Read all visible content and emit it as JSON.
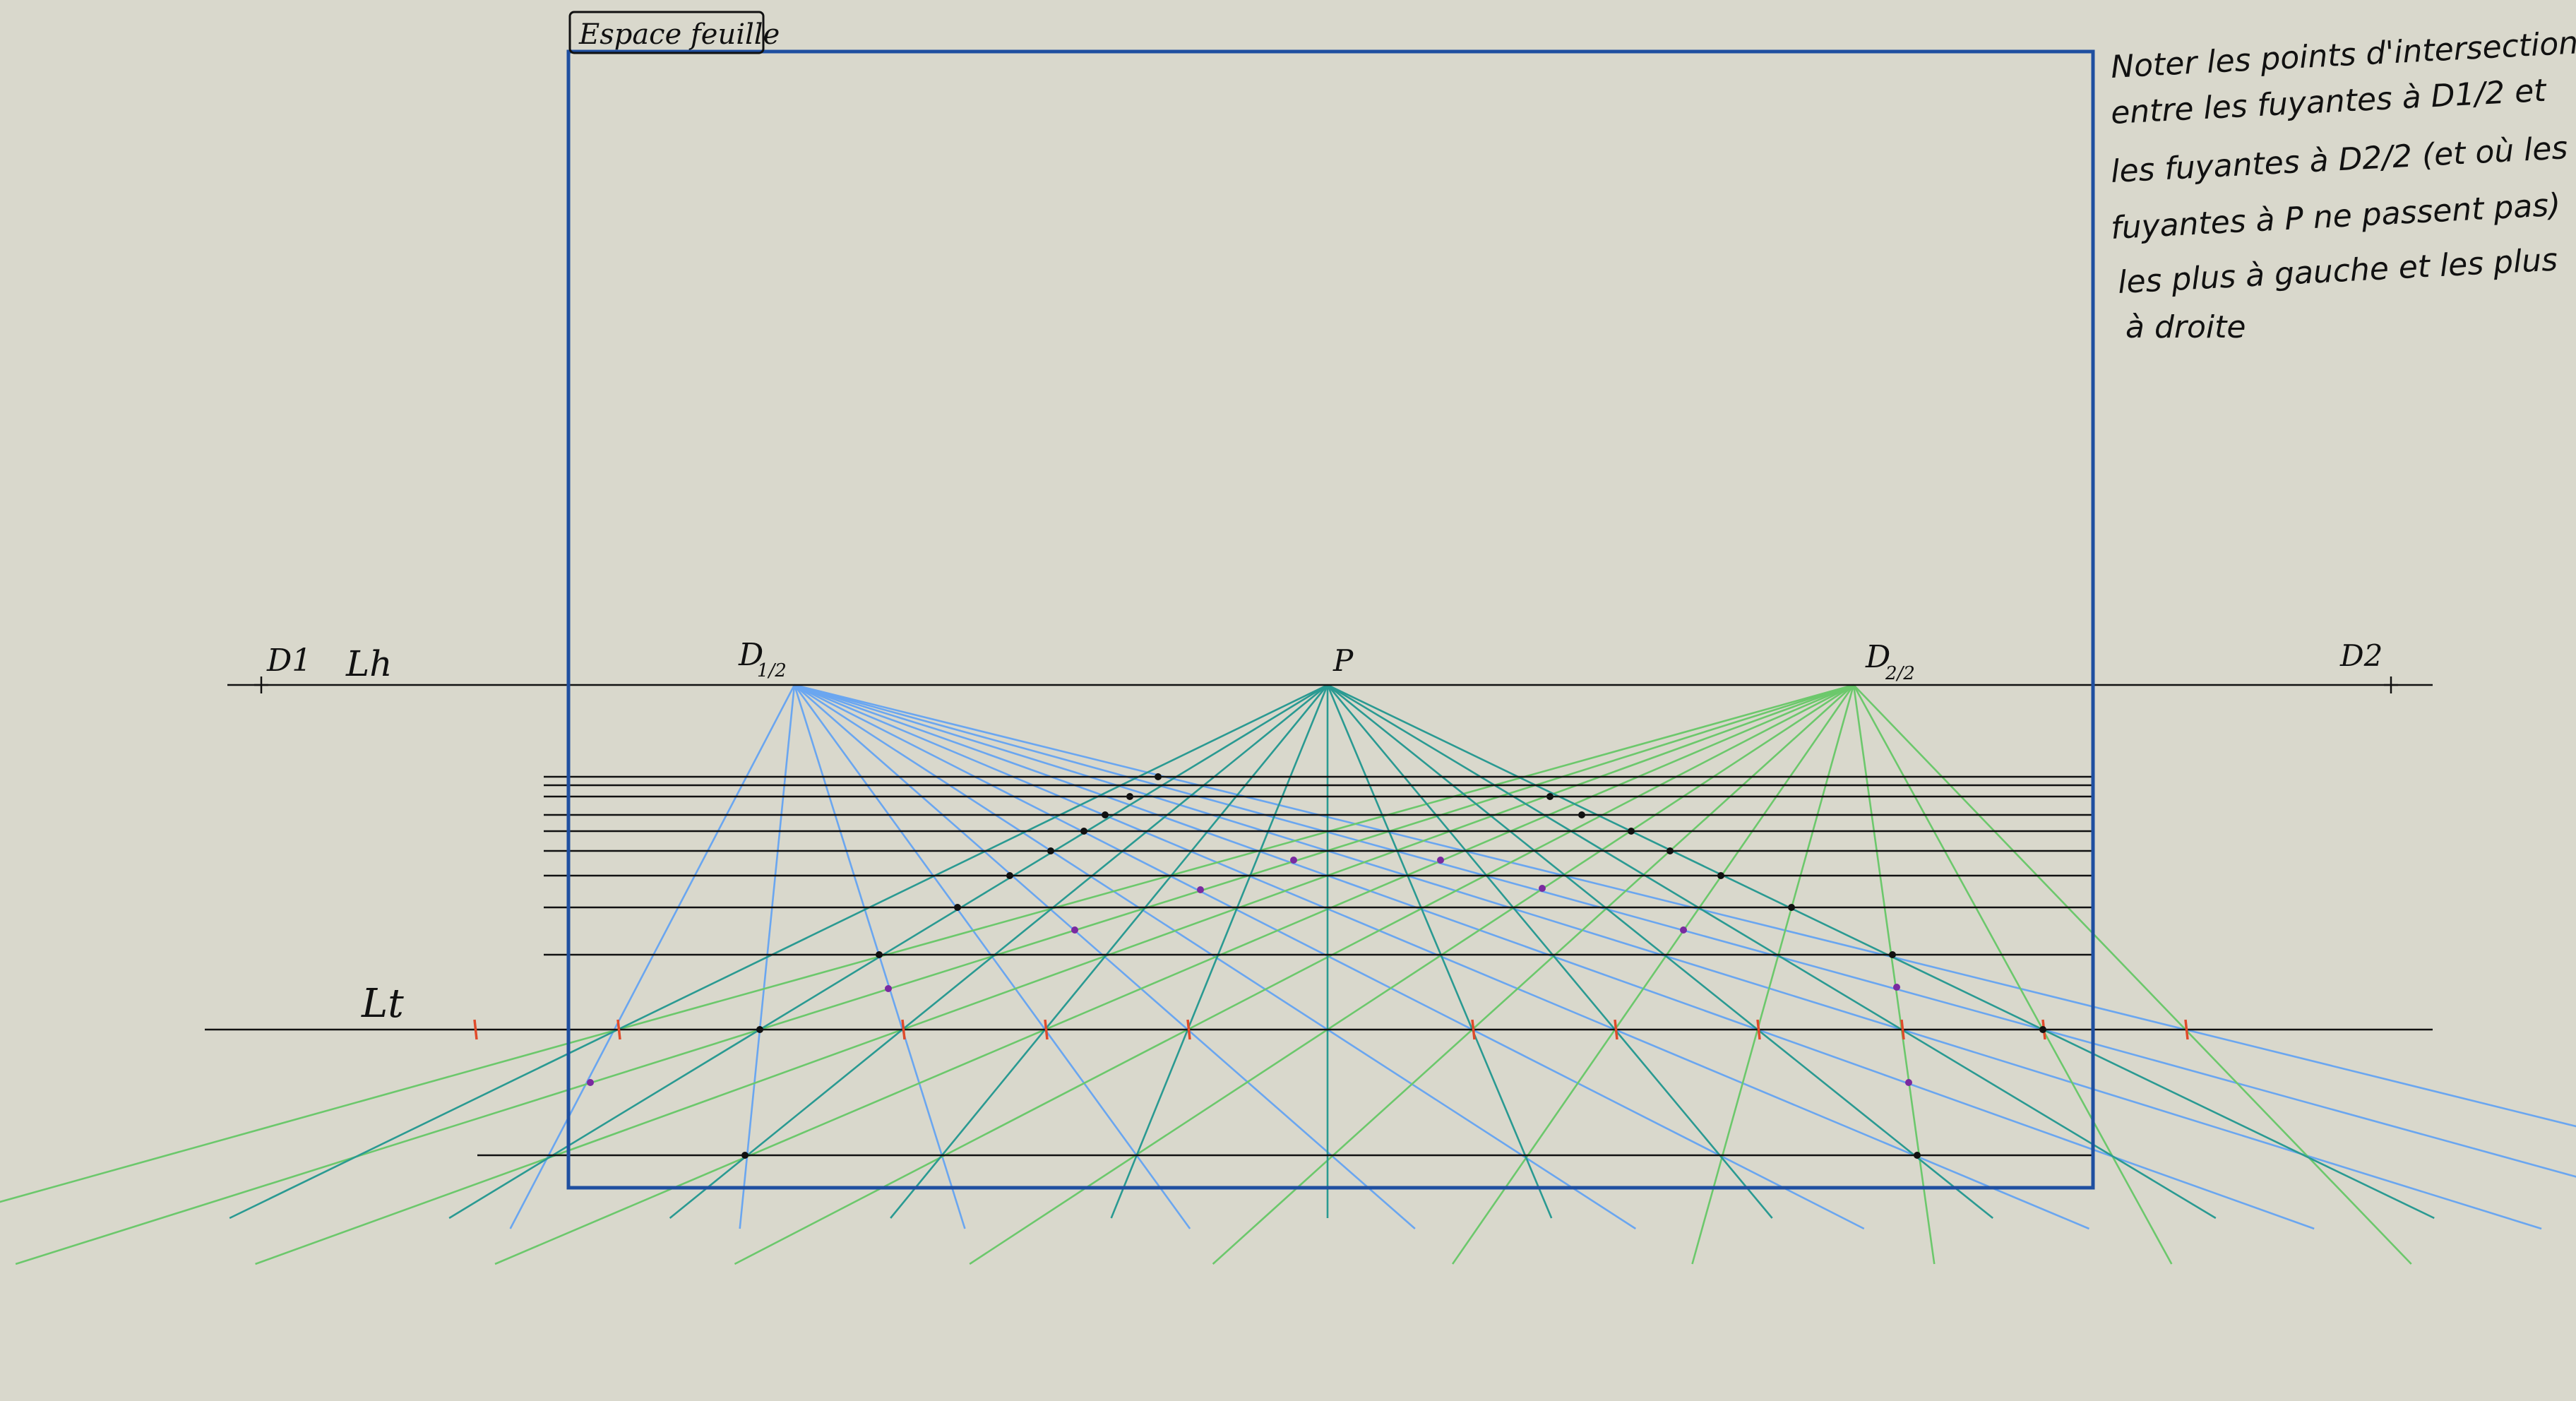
{
  "colors": {
    "background": "#d9d8cc",
    "frame": "#1f4fa0",
    "ink": "#111111",
    "blue_fuyantes": "#6aa6f0",
    "teal_fuyantes": "#2a9a92",
    "green_fuyantes": "#6cc86c",
    "red_ticks": "#e04a2a",
    "purple_points": "#7a2aa0"
  },
  "labels": {
    "frame_title": "Espace feuille",
    "horizon_line": "Lh",
    "ground_line": "Lt",
    "d1": "D1",
    "d1_half_main": "D",
    "d1_half_sub": "1/2",
    "p": "P",
    "d2_half_main": "D",
    "d2_half_sub": "2/2",
    "d2": "D2"
  },
  "note": {
    "lines": [
      "Noter les points d'intersection",
      "entre les fuyantes à D1/2 et",
      "les fuyantes à D2/2 (et où les",
      "fuyantes à P ne passent pas)",
      "les plus à gauche et les plus",
      "à droite"
    ]
  },
  "icons": {
    "point_marker": "black-dot-icon",
    "special_point": "purple-dot-icon",
    "ground_tick": "red-tick-icon"
  }
}
